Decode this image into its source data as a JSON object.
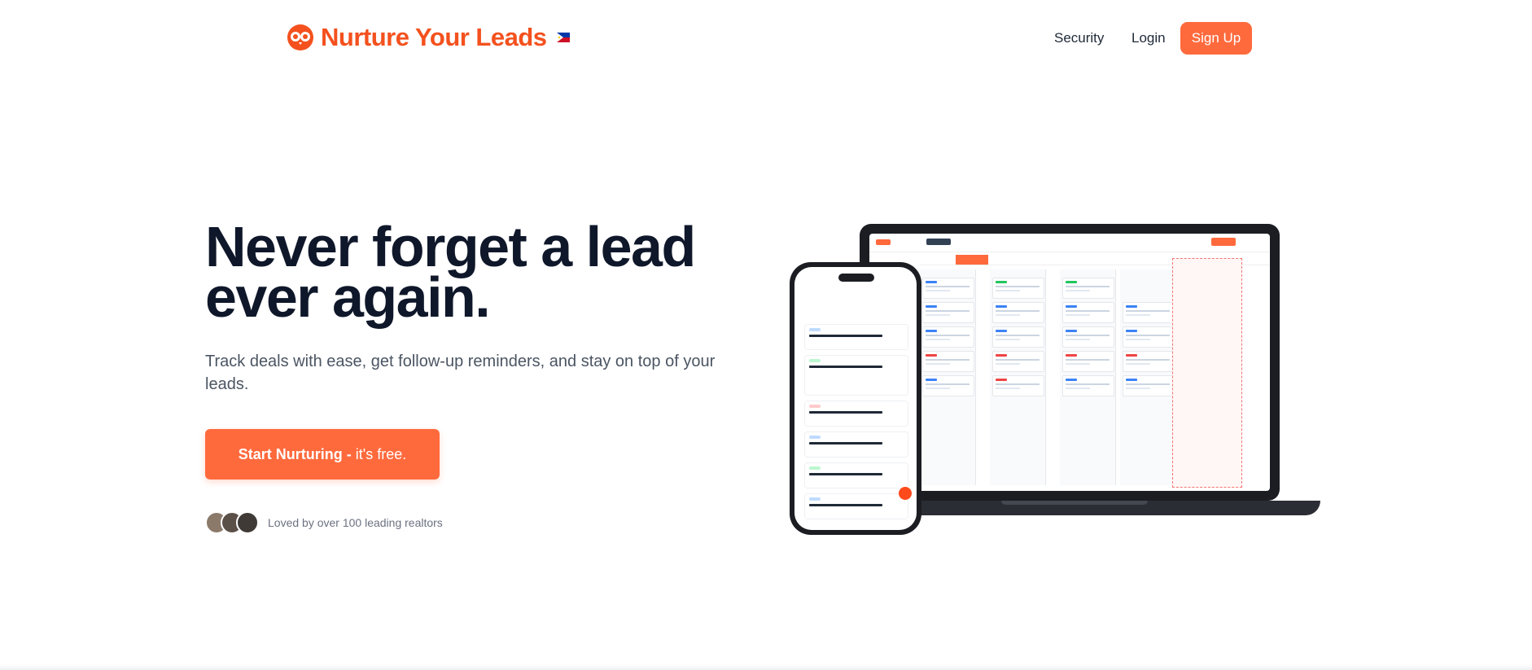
{
  "header": {
    "brand": "Nurture Your Leads",
    "nav": {
      "security": "Security",
      "login": "Login",
      "signup": "Sign Up"
    },
    "icons": [
      "owl-logo-icon",
      "philippines-flag-icon"
    ]
  },
  "hero": {
    "title_line1": "Never forget a lead",
    "title_line2": "ever again.",
    "subtitle": "Track deals with ease, get follow-up reminders, and stay on top of your leads.",
    "cta_strong": "Start Nurturing -",
    "cta_light": " it's free.",
    "social_proof": "Loved by over 100 leading realtors"
  },
  "colors": {
    "accent": "#ff6a3d",
    "brand": "#f4511e",
    "heading": "#0f172a"
  }
}
